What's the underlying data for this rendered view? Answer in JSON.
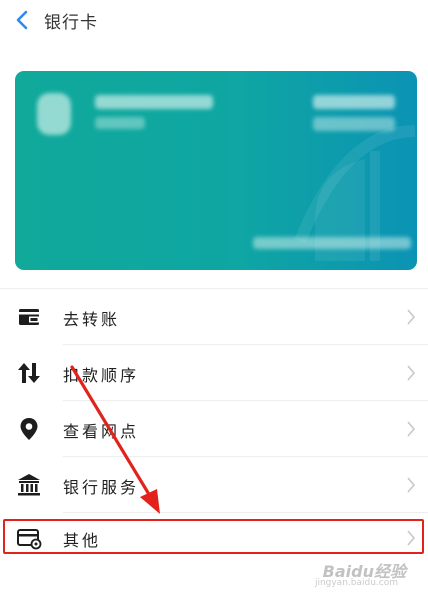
{
  "header": {
    "title": "银行卡",
    "back_icon": "chevron-left-icon"
  },
  "card": {
    "colors": {
      "start": "#10a99a",
      "end": "#0b93b4"
    }
  },
  "menu": {
    "items": [
      {
        "label": "去转账",
        "icon": "wallet-icon"
      },
      {
        "label": "扣款顺序",
        "icon": "sort-arrows-icon"
      },
      {
        "label": "查看网点",
        "icon": "location-pin-icon"
      },
      {
        "label": "银行服务",
        "icon": "bank-icon"
      },
      {
        "label": "其他",
        "icon": "card-settings-icon"
      }
    ]
  },
  "annotation": {
    "highlight_color": "#e1231b"
  },
  "watermark": {
    "text": "Baidu经验",
    "sub": "jingyan.baidu.com"
  }
}
